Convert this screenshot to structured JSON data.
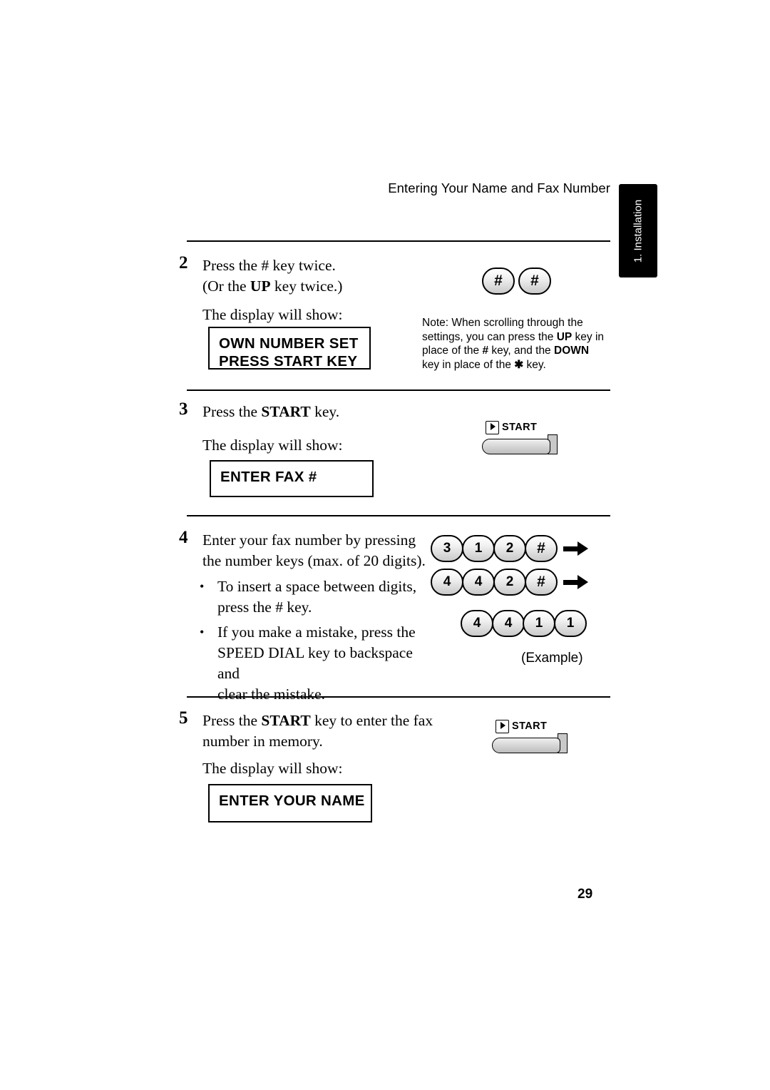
{
  "header": {
    "title": "Entering Your Name and Fax Number",
    "side_tab": "1. Installation"
  },
  "page_number": "29",
  "steps": [
    {
      "number": "2",
      "line1": "Press the # key twice.",
      "line2_pre": "(Or the ",
      "line2_bold": "UP",
      "line2_post": " key twice.)",
      "display_intro": "The display will show:",
      "lcd_line1": "OWN NUMBER SET",
      "lcd_line2": "PRESS START KEY",
      "keys": [
        "#",
        "#"
      ],
      "note": {
        "t1": "Note: When scrolling through the settings, you can press the ",
        "b1": "UP",
        "t2": " key in place of the ",
        "b2": "#",
        "t3": " key, and the ",
        "b3": "DOWN",
        "t4": " key in place of the ",
        "b4": "✱",
        "t5": " key."
      }
    },
    {
      "number": "3",
      "text_pre": "Press the ",
      "text_bold": "START",
      "text_post": " key.",
      "display_intro": "The display will show:",
      "lcd_line1": "ENTER FAX #",
      "start_label": "START"
    },
    {
      "number": "4",
      "line1": "Enter your fax number by pressing",
      "line2": "the number keys (max. of 20 digits).",
      "bullet1_l1": "To insert  a space between digits,",
      "bullet1_l2": "press the # key.",
      "bullet2_l1": "If you make a mistake, press the",
      "bullet2_bold": "SPEED DIAL",
      "bullet2_l2_post": " key to backspace and",
      "bullet2_l3": "clear the mistake.",
      "keypad_rows": [
        [
          "3",
          "1",
          "2",
          "#"
        ],
        [
          "4",
          "4",
          "2",
          "#"
        ],
        [
          "4",
          "4",
          "1",
          "1"
        ]
      ],
      "example_caption": "(Example)"
    },
    {
      "number": "5",
      "text_pre": "Press the ",
      "text_bold": "START",
      "text_post": " key to enter the fax",
      "text_line2": "number in memory.",
      "display_intro": "The display will show:",
      "lcd_line1": "ENTER YOUR NAME",
      "start_label": "START"
    }
  ]
}
